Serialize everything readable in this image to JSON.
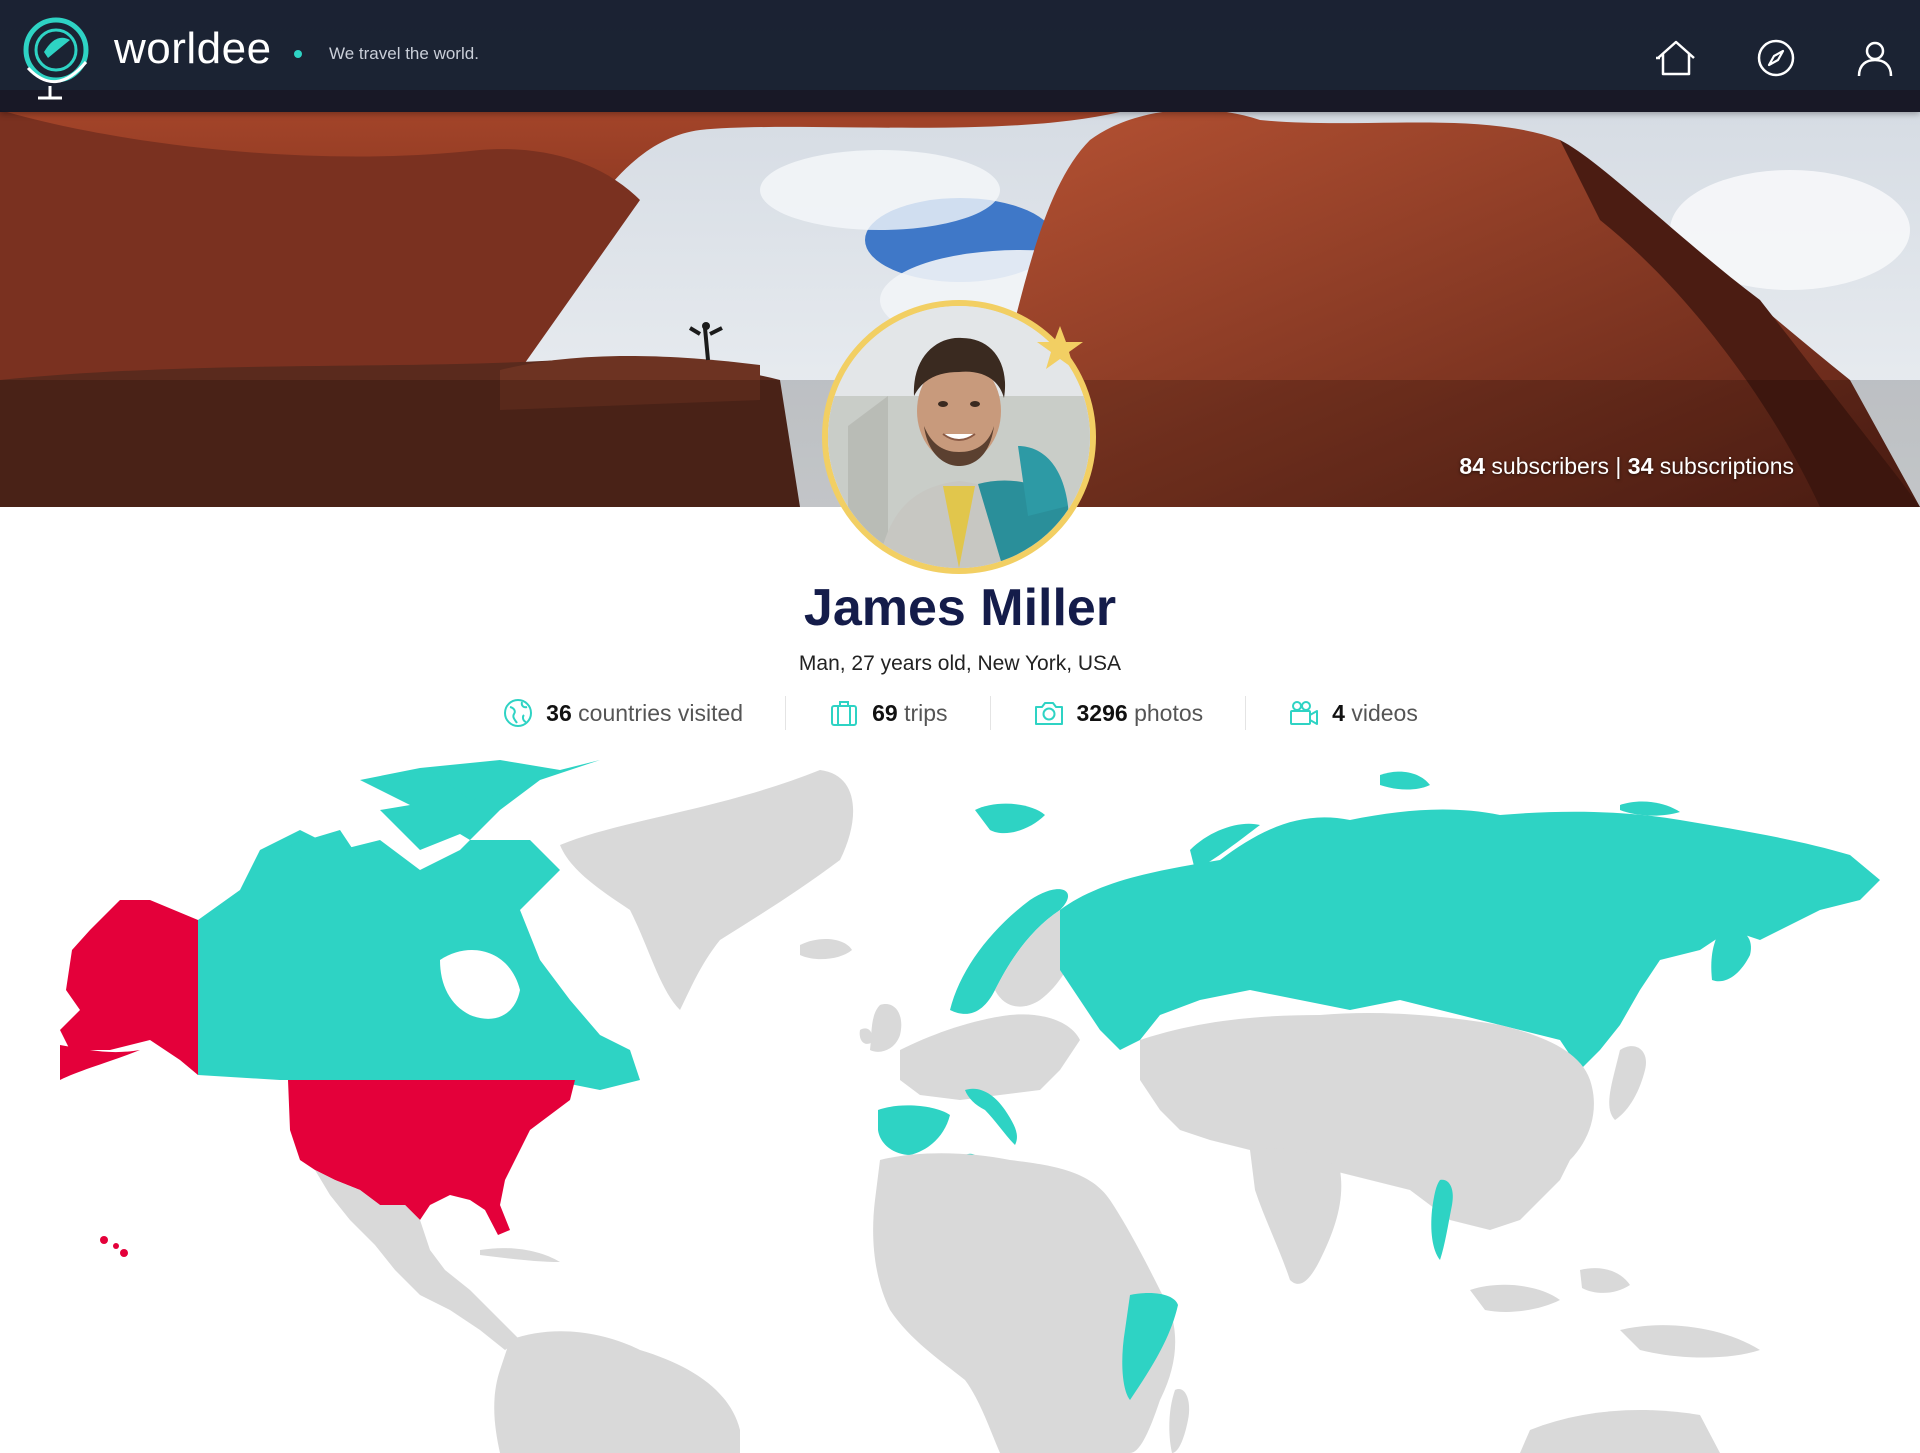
{
  "header": {
    "brand": "worldee",
    "tagline": "We travel the world.",
    "nav": [
      "home-icon",
      "compass-icon",
      "user-icon"
    ]
  },
  "cover": {
    "subscribers_count": "84",
    "subscribers_label": "subscribers",
    "subscriptions_count": "34",
    "subscriptions_label": "subscriptions"
  },
  "profile": {
    "name": "James Miller",
    "details": "Man, 27 years old, New York, USA",
    "stats": [
      {
        "icon": "globe-icon",
        "count": "36",
        "label": "countries visited"
      },
      {
        "icon": "suitcase-icon",
        "count": "69",
        "label": "trips"
      },
      {
        "icon": "camera-icon",
        "count": "3296",
        "label": "photos"
      },
      {
        "icon": "video-camera-icon",
        "count": "4",
        "label": "videos"
      }
    ]
  },
  "colors": {
    "accent": "#2ed3c4",
    "home_country": "#e4003a",
    "unvisited": "#d9d9d9",
    "name": "#141c4a",
    "topbar": "#0d1426",
    "avatar_ring": "#f2cf63"
  }
}
